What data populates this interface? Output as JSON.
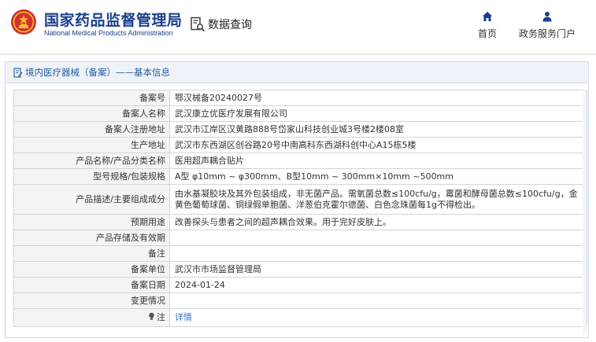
{
  "header": {
    "logo_cn": "国家药品监督管理局",
    "logo_en": "National Medical Products Administration",
    "query_label": "数据查询",
    "nav": [
      {
        "label": "首页",
        "icon": "home-icon"
      },
      {
        "label": "政务服务门户",
        "icon": "user-icon"
      }
    ]
  },
  "panel": {
    "title": "境内医疗器械（备案）——基本信息"
  },
  "rows": [
    {
      "label": "备案号",
      "value": "鄂汉械备20240027号"
    },
    {
      "label": "备案人名称",
      "value": "武汉康立优医疗发展有限公司"
    },
    {
      "label": "备案人注册地址",
      "value": "武汉市江岸区汉黄路888号岱家山科技创业城3号楼2楼08室"
    },
    {
      "label": "生产地址",
      "value": "武汉市东西湖区创谷路20号中南高科东西湖科创中心A15栋5楼"
    },
    {
      "label": "产品名称/产品分类名称",
      "value": "医用超声耦合贴片"
    },
    {
      "label": "型号规格/包装规格",
      "value": "A型 φ10mm ~ φ300mm、B型10mm ~ 300mm×10mm ~500mm"
    },
    {
      "label": "产品描述/主要组成成分",
      "value": "由水基凝胶块及其外包装组成，非无菌产品。需氧菌总数≤100cfu/g，霉菌和酵母菌总数≤100cfu/g，金黄色葡萄球菌、铜绿假单胞菌、洋葱伯克霍尔德菌、白色念珠菌每1g不得检出。"
    },
    {
      "label": "预期用途",
      "value": "改善探头与患者之间的超声耦合效果。用于完好皮肤上。"
    },
    {
      "label": "产品存储及有效期",
      "value": ""
    },
    {
      "label": "备注",
      "value": ""
    },
    {
      "label": "备案单位",
      "value": "武汉市市场监督管理局"
    },
    {
      "label": "备案日期",
      "value": "2024-01-24"
    },
    {
      "label": "变更情况",
      "value": ""
    }
  ],
  "note": {
    "label": "注",
    "link": "详情",
    "icon": "lightbulb-icon"
  },
  "colors": {
    "brand_blue": "#1a3f8c",
    "link_blue": "#3372c2",
    "emblem_red": "#d32f2f",
    "emblem_gold": "#f2c230"
  }
}
